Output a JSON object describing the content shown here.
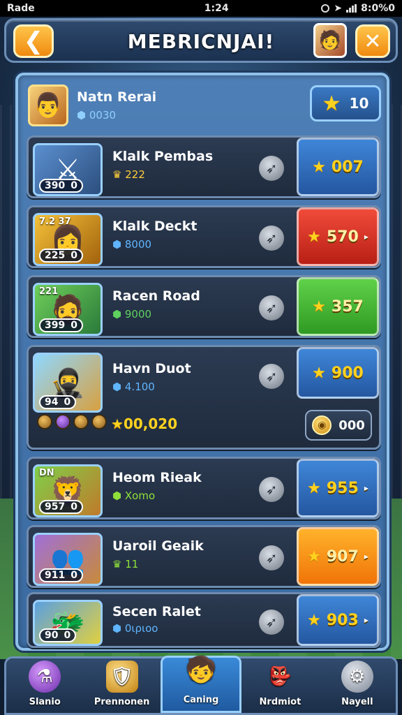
{
  "status_bar": {
    "carrier": "Rade",
    "time": "1:24",
    "battery": "8:0%0"
  },
  "header": {
    "title": "MEBRICNJAI!",
    "back_icon": "chevron-left-icon",
    "close_icon": "close-icon"
  },
  "player": {
    "name": "Natn Rerai",
    "sub": "0030",
    "coins": "10"
  },
  "items": [
    {
      "title": "Klalk Pembas",
      "sub": "222",
      "sub_icon": "crown-icon",
      "badge_left": "390",
      "badge_right": "0",
      "top_label": "",
      "price": "007",
      "color": "blue"
    },
    {
      "title": "Klalk Deckt",
      "sub": "8000",
      "sub_icon": "gem-icon",
      "badge_left": "225",
      "badge_right": "0",
      "top_label": "7.2 37",
      "price": "570",
      "color": "red"
    },
    {
      "title": "Racen Road",
      "sub": "9000",
      "sub_icon": "gem-icon",
      "badge_left": "399",
      "badge_right": "0",
      "top_label": "221",
      "price": "357",
      "color": "green"
    },
    {
      "title": "Havn Duot",
      "sub": "4.100",
      "sub_icon": "gem-icon",
      "badge_left": "94",
      "badge_right": "0",
      "top_label": "",
      "price": "900",
      "color": "blue",
      "extra_value": "00,020",
      "coin_value": "000"
    },
    {
      "title": "Heom Rieak",
      "sub": "Xomo",
      "sub_icon": "leaf-icon",
      "badge_left": "957",
      "badge_right": "0",
      "top_label": "DN",
      "price": "955",
      "color": "blue"
    },
    {
      "title": "Uaroil Geaik",
      "sub": "11",
      "sub_icon": "crown-icon",
      "badge_left": "911",
      "badge_right": "0",
      "top_label": "",
      "price": "907",
      "color": "orange"
    },
    {
      "title": "Secen Ralet",
      "sub": "0ιριοο",
      "sub_icon": "gem-icon",
      "badge_left": "90",
      "badge_right": "0",
      "top_label": "",
      "price": "903",
      "color": "blue"
    }
  ],
  "nav": {
    "items": [
      {
        "label": "Slanio",
        "icon": "potion-icon"
      },
      {
        "label": "Prennonen",
        "icon": "shield-icon"
      },
      {
        "label": "Caning",
        "icon": "hero-icon"
      },
      {
        "label": "Nrdmiot",
        "icon": "goblin-icon"
      },
      {
        "label": "Nayell",
        "icon": "gear-icon"
      }
    ]
  }
}
